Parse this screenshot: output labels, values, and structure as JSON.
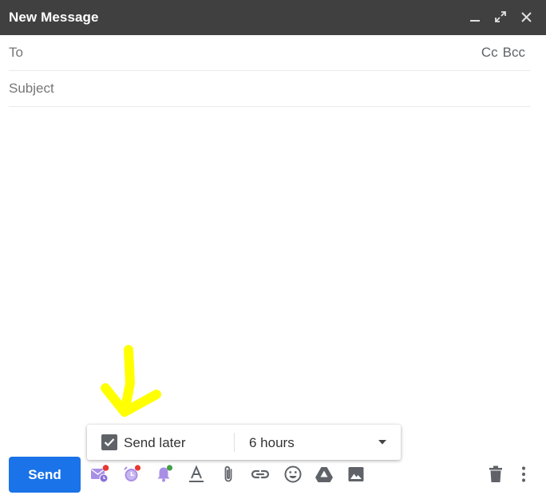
{
  "window": {
    "title": "New Message",
    "controls": [
      "minimize-icon",
      "expand-icon",
      "close-icon"
    ]
  },
  "fields": {
    "to_label": "To",
    "cc_label": "Cc",
    "bcc_label": "Bcc",
    "subject_placeholder": "Subject"
  },
  "send_later": {
    "checked": true,
    "label": "Send later",
    "selected_option": "6 hours"
  },
  "toolbar": {
    "send_label": "Send",
    "icons": [
      "scheduled-mail-icon",
      "alarm-clock-icon",
      "notification-bell-icon",
      "format-text-icon",
      "attach-icon",
      "link-icon",
      "emoji-icon",
      "drive-icon",
      "photo-icon",
      "trash-icon",
      "more-options-icon"
    ]
  },
  "colors": {
    "titlebar": "#404040",
    "send_button": "#1a73e8",
    "annotation_arrow": "#ffff00",
    "extension_icon": "#a98ee6",
    "badge_red": "#e53935",
    "badge_green": "#43a047"
  }
}
